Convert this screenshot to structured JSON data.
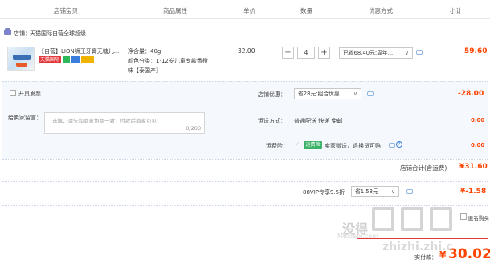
{
  "header": {
    "col_item": "店铺宝贝",
    "col_attr": "商品属性",
    "col_price": "单价",
    "col_qty": "数量",
    "col_discount": "优惠方式",
    "col_subtotal": "小计"
  },
  "shop": {
    "label": "店铺：",
    "name": "天猫国际自营全球超级"
  },
  "item": {
    "title": "【自营】LION狮王牙膏无糖儿...",
    "tag_tmall": "天猫国际",
    "attr_weight": "净含量：40g",
    "attr_color_1": "颜色分类：1-12岁儿童专款香橙",
    "attr_color_2": "味【泰国产】",
    "price": "32.00",
    "qty_minus": "−",
    "qty_value": "4",
    "qty_plus": "+",
    "discount": "已省68.40元:周年...",
    "subtotal": "59.60"
  },
  "invoice_label": "开具发票",
  "shop_discount": {
    "label": "店铺优惠：",
    "value": "省28元:组合优惠",
    "amount": "-28.00"
  },
  "note": {
    "label": "给卖家留言：",
    "placeholder": "选填，请先和商家协商一致，付款后商家可见",
    "counter": "0/200"
  },
  "shipping": {
    "label": "运送方式：",
    "value": "普通配送 快递 免邮",
    "amount": "0.00"
  },
  "insurance": {
    "label": "运费险：",
    "badge": "运费险",
    "text": "卖家赠送，退换货可赔",
    "amount": "0.00"
  },
  "shop_total": {
    "label": "店铺合计(含运费)",
    "amount": "¥31.60"
  },
  "vip": {
    "label": "88VIP专享9.5折",
    "value": "省1.58元",
    "amount": "¥-1.58"
  },
  "footer": {
    "anon_text": "匿名购买",
    "pay_label": "实付款：",
    "pay_currency": "¥",
    "pay_amount": "30.02"
  },
  "watermark": {
    "line1": "没得",
    "line2": "Meidebi.com",
    "line3": "zhizhi.zhi.c"
  },
  "colors": {
    "accent": "#ff4400",
    "panel_bg": "#f5f9fe",
    "tag_tmall": "#e4393c",
    "badge_green": "#3db36a"
  }
}
